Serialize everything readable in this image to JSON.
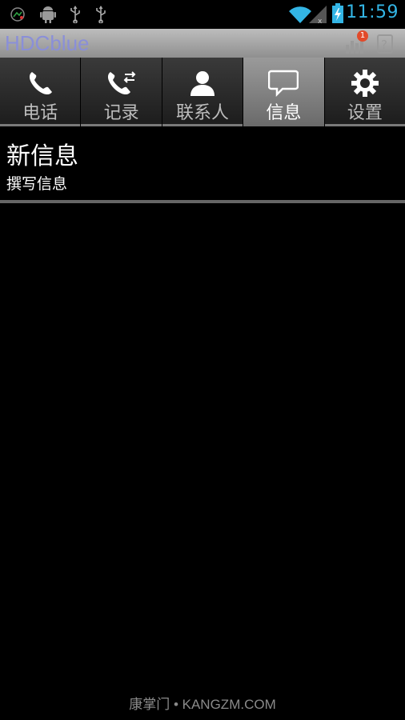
{
  "status_bar": {
    "time": "11:59",
    "left_icons": [
      "gauge-icon",
      "android-debug-icon",
      "usb-icon",
      "usb-icon"
    ],
    "right_icons": [
      "wifi-icon",
      "signal-icon",
      "battery-charging-icon"
    ],
    "time_color": "#33b5e5"
  },
  "app_bar": {
    "title": "HDCblue",
    "title_color": "#8a8fd8",
    "badge_count": "1",
    "icons": [
      "stats-icon",
      "help-icon"
    ]
  },
  "tabs": [
    {
      "label": "电话",
      "icon": "phone-icon",
      "active": false
    },
    {
      "label": "记录",
      "icon": "call-log-icon",
      "active": false
    },
    {
      "label": "联系人",
      "icon": "contact-icon",
      "active": false
    },
    {
      "label": "信息",
      "icon": "message-icon",
      "active": true
    },
    {
      "label": "设置",
      "icon": "gear-icon",
      "active": false
    }
  ],
  "main": {
    "title": "新信息",
    "subtitle": "撰写信息"
  },
  "watermark": "康掌门 • KANGZM.COM"
}
